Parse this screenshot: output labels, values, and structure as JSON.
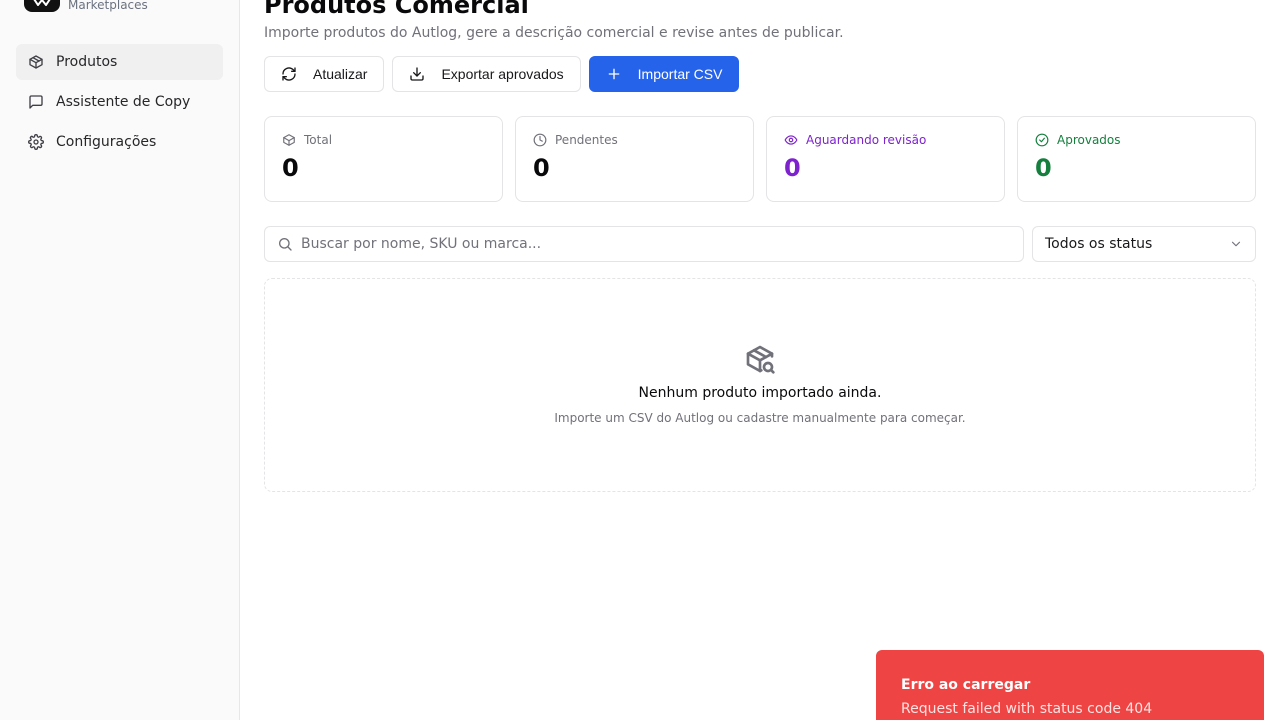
{
  "app": {
    "brand_sub": "Marketplaces"
  },
  "sidebar": {
    "items": [
      {
        "label": "Produtos",
        "icon": "package-icon",
        "active": true
      },
      {
        "label": "Assistente de Copy",
        "icon": "message-square-icon",
        "active": false
      },
      {
        "label": "Configurações",
        "icon": "gear-icon",
        "active": false
      }
    ]
  },
  "header": {
    "title": "Produtos Comercial",
    "subtitle": "Importe produtos do Autlog, gere a descrição comercial e revise antes de publicar."
  },
  "actions": {
    "refresh_label": "Atualizar",
    "export_label": "Exportar aprovados",
    "import_label": "Importar CSV"
  },
  "stats": [
    {
      "label": "Total",
      "value": "0",
      "icon": "package-icon"
    },
    {
      "label": "Pendentes",
      "value": "0",
      "icon": "clock-icon"
    },
    {
      "label": "Aguardando revisão",
      "value": "0",
      "icon": "eye-icon",
      "color": "#7e22ce"
    },
    {
      "label": "Aprovados",
      "value": "0",
      "icon": "check-circle-icon",
      "color": "#15803d"
    }
  ],
  "filters": {
    "search_placeholder": "Buscar por nome, SKU ou marca...",
    "search_value": "",
    "status_selected": "Todos os status"
  },
  "empty_state": {
    "icon": "package-search-icon",
    "title": "Nenhum produto importado ainda.",
    "subtitle": "Importe um CSV do Autlog ou cadastre manualmente para começar."
  },
  "toast": {
    "title": "Erro ao carregar",
    "message": "Request failed with status code 404",
    "color": "#ef4444"
  },
  "colors": {
    "primary": "#2563eb",
    "purple": "#7e22ce",
    "green": "#15803d"
  }
}
